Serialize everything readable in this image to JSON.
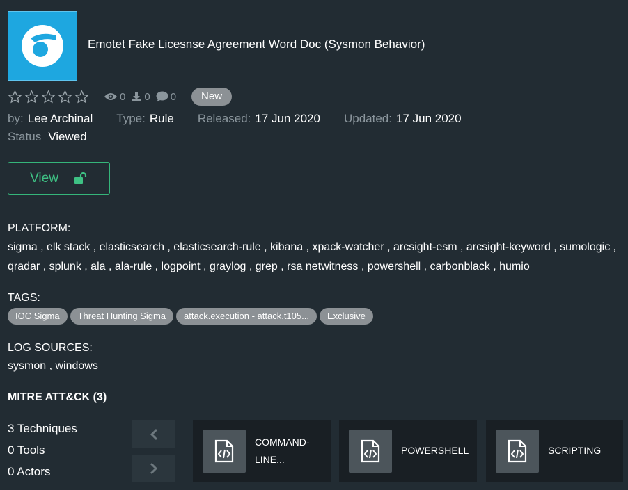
{
  "header": {
    "title": "Emotet Fake Licesnse Agreement Word Doc (Sysmon Behavior)"
  },
  "stats": {
    "views": "0",
    "downloads": "0",
    "comments": "0",
    "badge": "New"
  },
  "meta": {
    "by_label": "by:",
    "by_value": "Lee Archinal",
    "type_label": "Type:",
    "type_value": "Rule",
    "released_label": "Released:",
    "released_value": "17 Jun 2020",
    "updated_label": "Updated:",
    "updated_value": "17 Jun 2020",
    "status_label": "Status",
    "status_value": "Viewed"
  },
  "actions": {
    "view_label": "View"
  },
  "platform": {
    "heading": "PLATFORM:",
    "line1": "sigma , elk stack , elasticsearch , elasticsearch-rule , kibana , xpack-watcher , arcsight-esm , arcsight-keyword , sumologic ,",
    "line2": "qradar , splunk , ala , ala-rule , logpoint , graylog , grep , rsa netwitness , powershell , carbonblack , humio"
  },
  "tags": {
    "heading": "TAGS:",
    "items": [
      "IOC Sigma",
      "Threat Hunting Sigma",
      "attack.execution - attack.t105...",
      "Exclusive"
    ]
  },
  "log_sources": {
    "heading": "LOG SOURCES:",
    "text": "sysmon , windows"
  },
  "mitre": {
    "heading": "MITRE ATT&CK (3)",
    "techniques": "3 Techniques",
    "tools": "0 Tools",
    "actors": "0 Actors",
    "cards": [
      {
        "line1": "COMMAND-",
        "line2": "LINE..."
      },
      {
        "line1": "POWERSHELL",
        "line2": ""
      },
      {
        "line1": "SCRIPTING",
        "line2": ""
      }
    ]
  },
  "colors": {
    "accent": "#3ec184",
    "background": "#222c33",
    "logo": "#1ea7e0"
  },
  "rating": {
    "value": 0,
    "max": 5
  }
}
